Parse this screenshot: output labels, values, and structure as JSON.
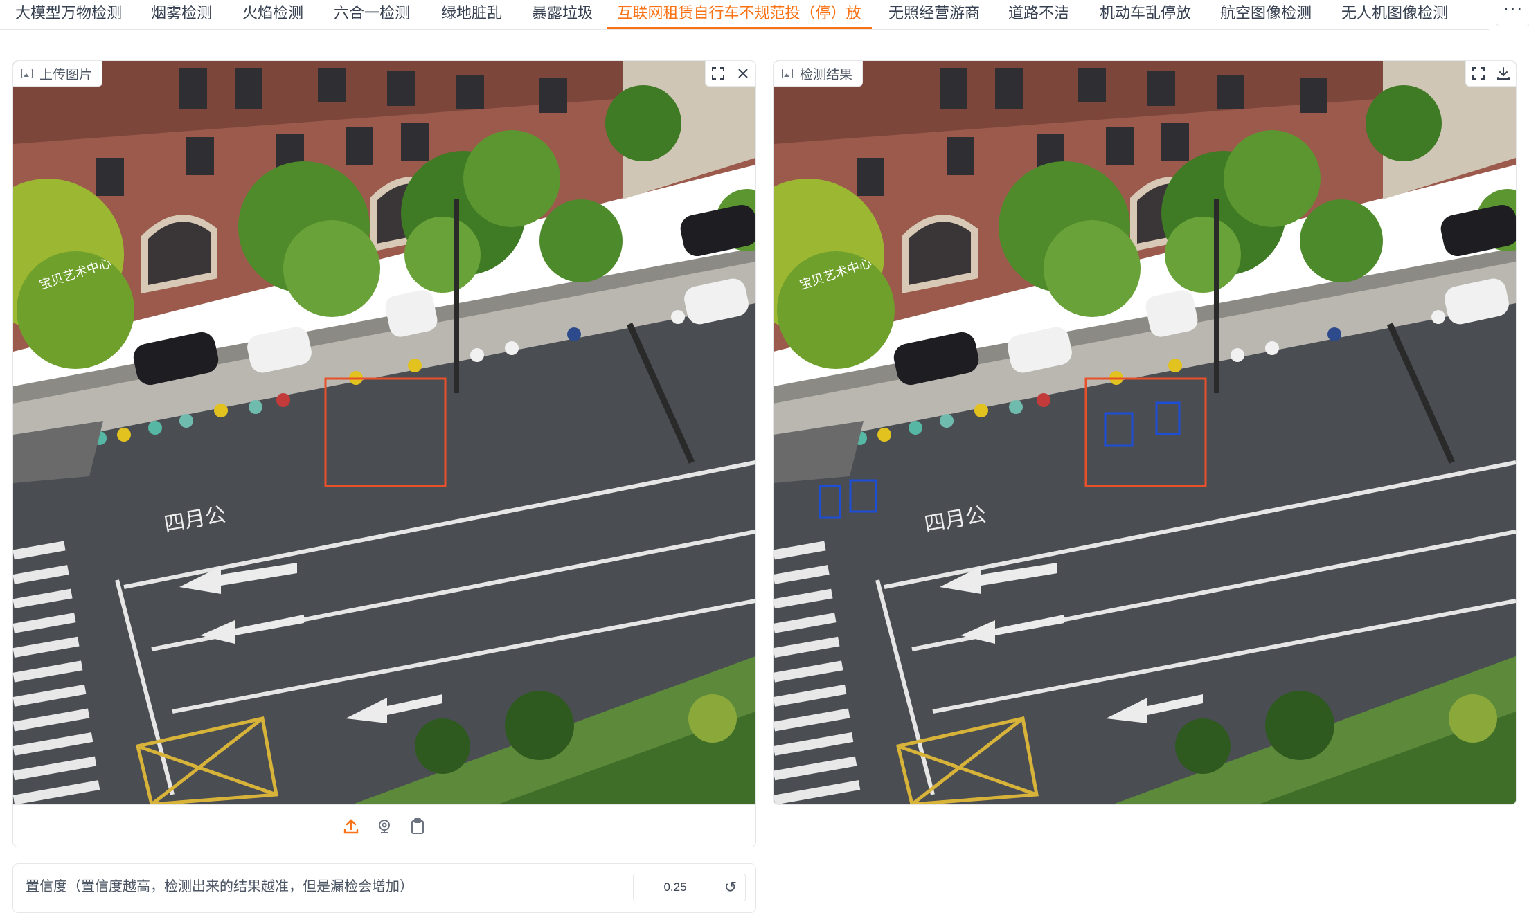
{
  "tabs": [
    {
      "label": "大模型万物检测",
      "active": false
    },
    {
      "label": "烟雾检测",
      "active": false
    },
    {
      "label": "火焰检测",
      "active": false
    },
    {
      "label": "六合一检测",
      "active": false
    },
    {
      "label": "绿地脏乱",
      "active": false
    },
    {
      "label": "暴露垃圾",
      "active": false
    },
    {
      "label": "互联网租赁自行车不规范投（停）放",
      "active": true
    },
    {
      "label": "无照经营游商",
      "active": false
    },
    {
      "label": "道路不洁",
      "active": false
    },
    {
      "label": "机动车乱停放",
      "active": false
    },
    {
      "label": "航空图像检测",
      "active": false
    },
    {
      "label": "无人机图像检测",
      "active": false
    }
  ],
  "more_menu": "···",
  "upload_panel": {
    "label": "上传图片",
    "icons": [
      "fullscreen-icon",
      "close-icon"
    ],
    "toolbar_icons": [
      "upload-icon",
      "webcam-icon",
      "clipboard-icon"
    ]
  },
  "result_panel": {
    "label": "检测结果",
    "icons": [
      "fullscreen-icon",
      "download-icon"
    ]
  },
  "scene": {
    "road_text": "四月公",
    "shop_sign": "宝贝艺术中心"
  },
  "confidence": {
    "label": "置信度（置信度越高，检测出来的结果越准，但是漏检会增加）",
    "value": "0.25",
    "reset_icon": "↺"
  },
  "colors": {
    "accent": "#f97316",
    "roi_box": "#e8502a",
    "detection_box": "#1d4ed8"
  }
}
